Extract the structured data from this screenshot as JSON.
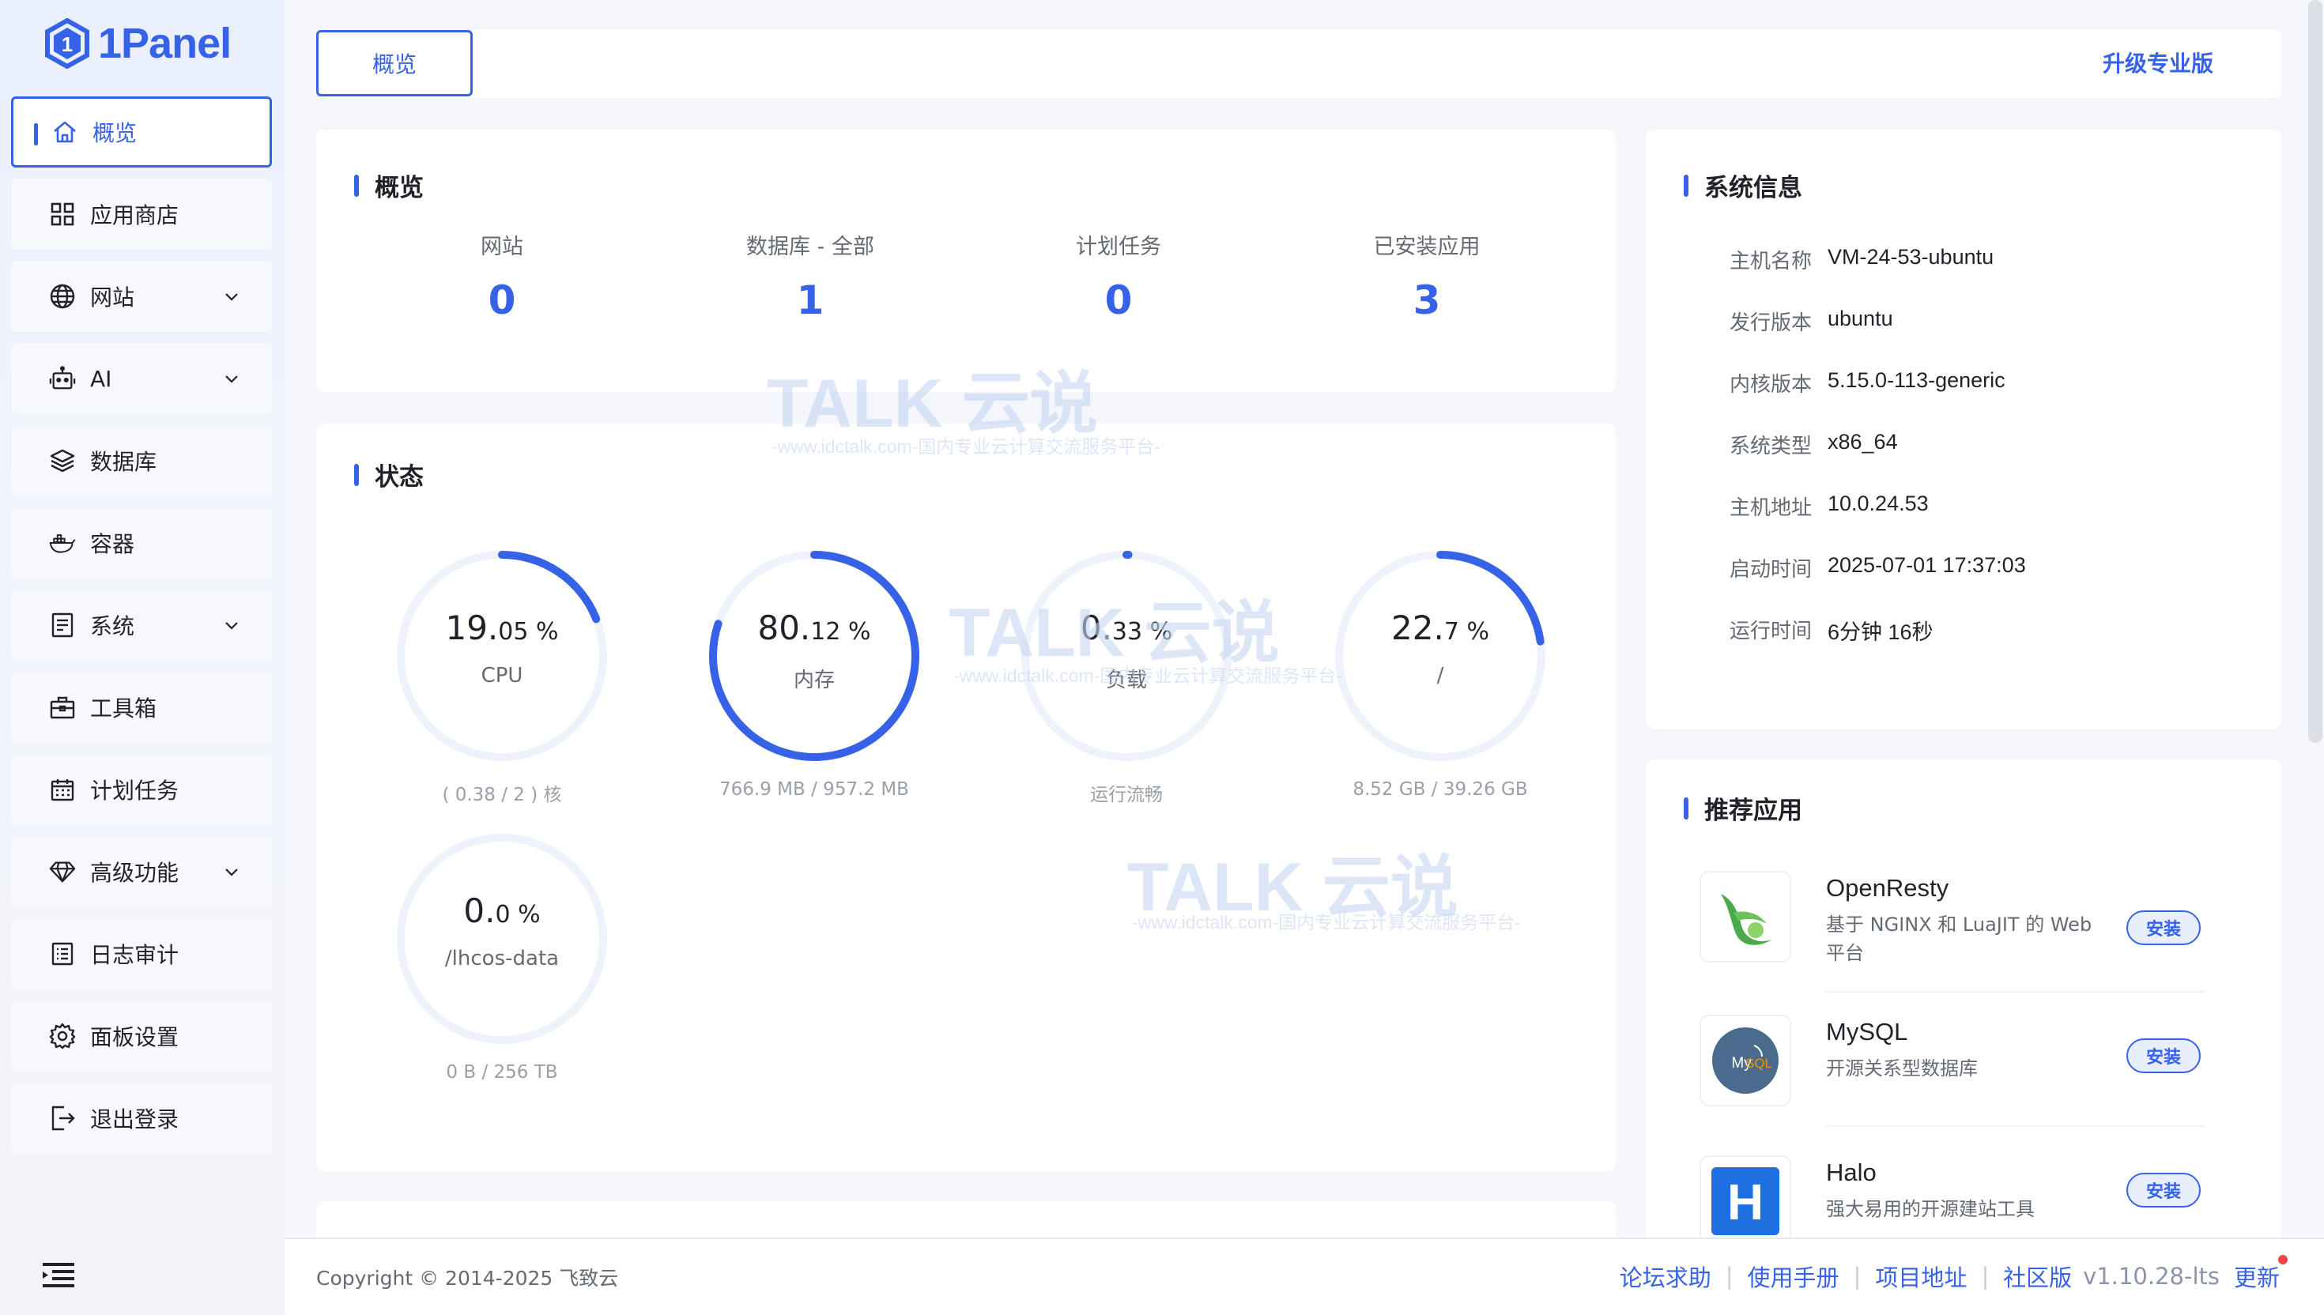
{
  "brand": {
    "name": "1Panel"
  },
  "sidebar": {
    "items": [
      {
        "label": "概览",
        "icon": "home-icon",
        "active": true
      },
      {
        "label": "应用商店",
        "icon": "grid-icon"
      },
      {
        "label": "网站",
        "icon": "globe-icon",
        "expandable": true
      },
      {
        "label": "AI",
        "icon": "robot-icon",
        "expandable": true
      },
      {
        "label": "数据库",
        "icon": "layers-icon"
      },
      {
        "label": "容器",
        "icon": "docker-icon"
      },
      {
        "label": "系统",
        "icon": "document-icon",
        "expandable": true
      },
      {
        "label": "工具箱",
        "icon": "toolbox-icon"
      },
      {
        "label": "计划任务",
        "icon": "calendar-icon"
      },
      {
        "label": "高级功能",
        "icon": "diamond-icon",
        "expandable": true
      },
      {
        "label": "日志审计",
        "icon": "log-icon"
      },
      {
        "label": "面板设置",
        "icon": "gear-icon"
      },
      {
        "label": "退出登录",
        "icon": "logout-icon"
      }
    ]
  },
  "topbar": {
    "tab_label": "概览",
    "upgrade_label": "升级专业版"
  },
  "overview": {
    "title": "概览",
    "stats": [
      {
        "label": "网站",
        "value": "0"
      },
      {
        "label": "数据库 - 全部",
        "value": "1"
      },
      {
        "label": "计划任务",
        "value": "0"
      },
      {
        "label": "已安装应用",
        "value": "3"
      }
    ]
  },
  "status": {
    "title": "状态",
    "gauges": [
      {
        "int": "19.",
        "dec": "05",
        "unit": " %",
        "label": "CPU",
        "detail": "( 0.38 / 2 ) 核",
        "percent": 19.05
      },
      {
        "int": "80.",
        "dec": "12",
        "unit": " %",
        "label": "内存",
        "detail": "766.9 MB / 957.2 MB",
        "percent": 80.12
      },
      {
        "int": "0.",
        "dec": "33",
        "unit": " %",
        "label": "负载",
        "detail": "运行流畅",
        "percent": 0.33
      },
      {
        "int": "22.",
        "dec": "7",
        "unit": " %",
        "label": "/",
        "detail": "8.52 GB / 39.26 GB",
        "percent": 22.7
      },
      {
        "int": "0.",
        "dec": "0",
        "unit": " %",
        "label": "/lhcos-data",
        "detail": "0 B / 256 TB",
        "percent": 0
      }
    ]
  },
  "system_info": {
    "title": "系统信息",
    "rows": [
      {
        "key": "主机名称",
        "value": "VM-24-53-ubuntu"
      },
      {
        "key": "发行版本",
        "value": "ubuntu"
      },
      {
        "key": "内核版本",
        "value": "5.15.0-113-generic"
      },
      {
        "key": "系统类型",
        "value": "x86_64"
      },
      {
        "key": "主机地址",
        "value": "10.0.24.53"
      },
      {
        "key": "启动时间",
        "value": "2025-07-01 17:37:03"
      },
      {
        "key": "运行时间",
        "value": "6分钟 16秒"
      }
    ]
  },
  "recommended": {
    "title": "推荐应用",
    "apps": [
      {
        "name": "OpenResty",
        "desc": "基于 NGINX 和 LuaJIT 的 Web 平台",
        "install_label": "安装",
        "icon": "openresty-icon"
      },
      {
        "name": "MySQL",
        "desc": "开源关系型数据库",
        "install_label": "安装",
        "icon": "mysql-icon"
      },
      {
        "name": "Halo",
        "desc": "强大易用的开源建站工具",
        "install_label": "安装",
        "icon": "halo-icon"
      }
    ]
  },
  "footer": {
    "copyright": "Copyright © 2014-2025 飞致云",
    "links": [
      "论坛求助",
      "使用手册",
      "项目地址",
      "社区版"
    ],
    "version": "v1.10.28-lts",
    "update_label": "更新"
  },
  "watermark": {
    "brand": "TALK 云说",
    "sub": "-www.idctalk.com-国内专业云计算交流服务平台-"
  },
  "colors": {
    "accent": "#3662e8",
    "track": "#eef2fb"
  }
}
